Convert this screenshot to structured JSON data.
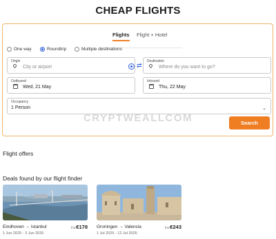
{
  "header": {
    "title": "CHEAP FLIGHTS"
  },
  "search": {
    "tabs": [
      {
        "label": "Flights",
        "active": true
      },
      {
        "label": "Flight + Hotel",
        "active": false
      }
    ],
    "trip_types": [
      {
        "label": "One way",
        "selected": false
      },
      {
        "label": "Roundtrip",
        "selected": true
      },
      {
        "label": "Multiple destinations",
        "selected": false
      }
    ],
    "origin": {
      "label": "Origin",
      "placeholder": "City or airport",
      "icon": "map-pin-icon"
    },
    "destination": {
      "label": "Destination",
      "placeholder": "Where do you want to go?",
      "icon": "map-pin-icon"
    },
    "outbound": {
      "label": "Outbound",
      "value": "Wed, 21 May",
      "icon": "calendar-icon"
    },
    "inbound": {
      "label": "Inbound",
      "value": "Thu, 22 May",
      "icon": "calendar-icon"
    },
    "occupancy": {
      "label": "Occupancy",
      "value": "1 Person"
    },
    "search_button": "Search",
    "accent_color": "#ef7d22",
    "link_color": "#2a5bd7"
  },
  "watermark": "CRYPTWEALLCOM",
  "flight_offers": {
    "title": "Flight offers"
  },
  "deals": {
    "title": "Deals found by our flight finder",
    "items": [
      {
        "route": "Eindhoven → Istanbul",
        "from_label": "from",
        "price": "€178",
        "dates": "1 Jun 2025 - 3 Jun 2025"
      },
      {
        "route": "Groningen → Valencia",
        "from_label": "from",
        "price": "€243",
        "dates": "1 Jul 2025 - 12 Jul 2025"
      }
    ]
  }
}
